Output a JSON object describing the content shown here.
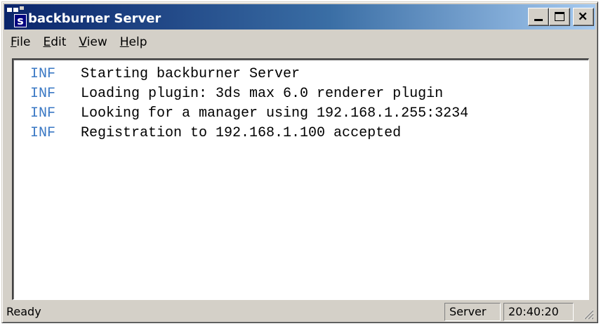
{
  "window": {
    "title": "backburner Server",
    "icon": "backburner-server-icon",
    "icon_letter": "s"
  },
  "menu": {
    "items": [
      {
        "label": "File",
        "mnemonic": "F",
        "rest": "ile"
      },
      {
        "label": "Edit",
        "mnemonic": "E",
        "rest": "dit"
      },
      {
        "label": "View",
        "mnemonic": "V",
        "rest": "iew"
      },
      {
        "label": "Help",
        "mnemonic": "H",
        "rest": "elp"
      }
    ]
  },
  "log": {
    "rows": [
      {
        "level": "INF",
        "message": "Starting backburner Server"
      },
      {
        "level": "INF",
        "message": "Loading plugin: 3ds max 6.0 renderer plugin"
      },
      {
        "level": "INF",
        "message": "Looking for a manager using 192.168.1.255:3234"
      },
      {
        "level": "INF",
        "message": "Registration to 192.168.1.100 accepted"
      }
    ]
  },
  "status": {
    "text": "Ready",
    "mode": "Server",
    "time": "20:40:20"
  },
  "colors": {
    "title_gradient_start": "#0a246a",
    "title_gradient_end": "#a6caf0",
    "log_level": "#3a78c4",
    "face": "#d4d0c8"
  }
}
